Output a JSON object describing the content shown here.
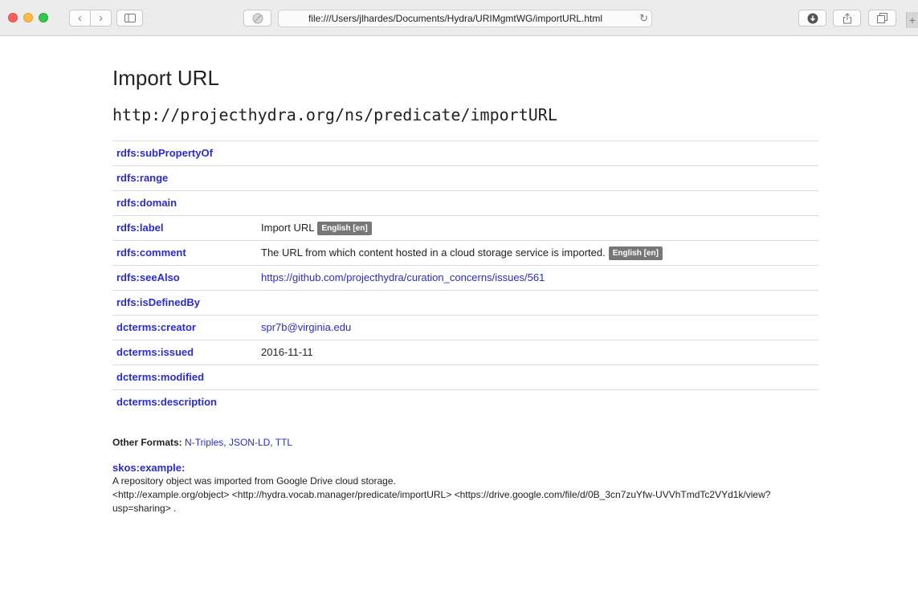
{
  "browser": {
    "url": "file:///Users/jlhardes/Documents/Hydra/URIMgmtWG/importURL.html",
    "icons": [
      "close-icon",
      "minimize-icon",
      "zoom-icon",
      "back-icon",
      "forward-icon",
      "sidebar-icon",
      "privacy-icon",
      "reload-icon",
      "download-icon",
      "share-icon",
      "tabs-icon",
      "new-tab-icon"
    ],
    "traffic_colors": {
      "close": "#fc605c",
      "minimize": "#fdbc40",
      "zoom": "#34c84a"
    }
  },
  "page": {
    "title": "Import URL",
    "uri": "http://projecthydra.org/ns/predicate/importURL",
    "link_color": "#2a2ad6",
    "badge_color": "#777777",
    "properties": [
      {
        "key": "rdfs:subPropertyOf",
        "value": "",
        "badge": ""
      },
      {
        "key": "rdfs:range",
        "value": "",
        "badge": ""
      },
      {
        "key": "rdfs:domain",
        "value": "",
        "badge": ""
      },
      {
        "key": "rdfs:label",
        "value": "Import URL",
        "badge": "English [en]"
      },
      {
        "key": "rdfs:comment",
        "value": "The URL from which content hosted in a cloud storage service is imported.",
        "badge": "English [en]"
      },
      {
        "key": "rdfs:seeAlso",
        "value": "https://github.com/projecthydra/curation_concerns/issues/561",
        "badge": ""
      },
      {
        "key": "rdfs:isDefinedBy",
        "value": "",
        "badge": ""
      },
      {
        "key": "dcterms:creator",
        "value": "spr7b@virginia.edu",
        "badge": ""
      },
      {
        "key": "dcterms:issued",
        "value": "2016-11-11",
        "badge": ""
      },
      {
        "key": "dcterms:modified",
        "value": "",
        "badge": ""
      },
      {
        "key": "dcterms:description",
        "value": "",
        "badge": ""
      }
    ],
    "other_formats": {
      "label": "Other Formats:",
      "links": [
        "N-Triples",
        "JSON-LD",
        "TTL"
      ],
      "sep1": ", ",
      "sep2": ", "
    },
    "example": {
      "key": "skos:example:",
      "line1": "A repository object was imported from Google Drive cloud storage.",
      "line2": "<http://example.org/object> <http://hydra.vocab.manager/predicate/importURL> <https://drive.google.com/file/d/0B_3cn7zuYfw-UVVhTmdTc2VYd1k/view?usp=sharing> ."
    }
  }
}
